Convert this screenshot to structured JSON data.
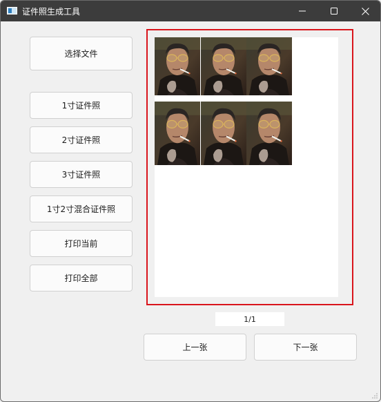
{
  "window": {
    "title": "证件照生成工具",
    "icon": "app-window-icon",
    "controls": [
      "minimize-icon",
      "maximize-icon",
      "close-icon"
    ]
  },
  "sidebar": {
    "select_file": "选择文件",
    "one_inch": "1寸证件照",
    "two_inch": "2寸证件照",
    "three_inch": "3寸证件照",
    "mixed": "1寸2寸混合证件照",
    "print_current": "打印当前",
    "print_all": "打印全部"
  },
  "preview": {
    "border_color": "#d9141b",
    "rows": 2,
    "photos_per_row": 3,
    "photo_count": 6
  },
  "pagination": {
    "indicator": "1/1",
    "prev": "上一张",
    "next": "下一张"
  }
}
